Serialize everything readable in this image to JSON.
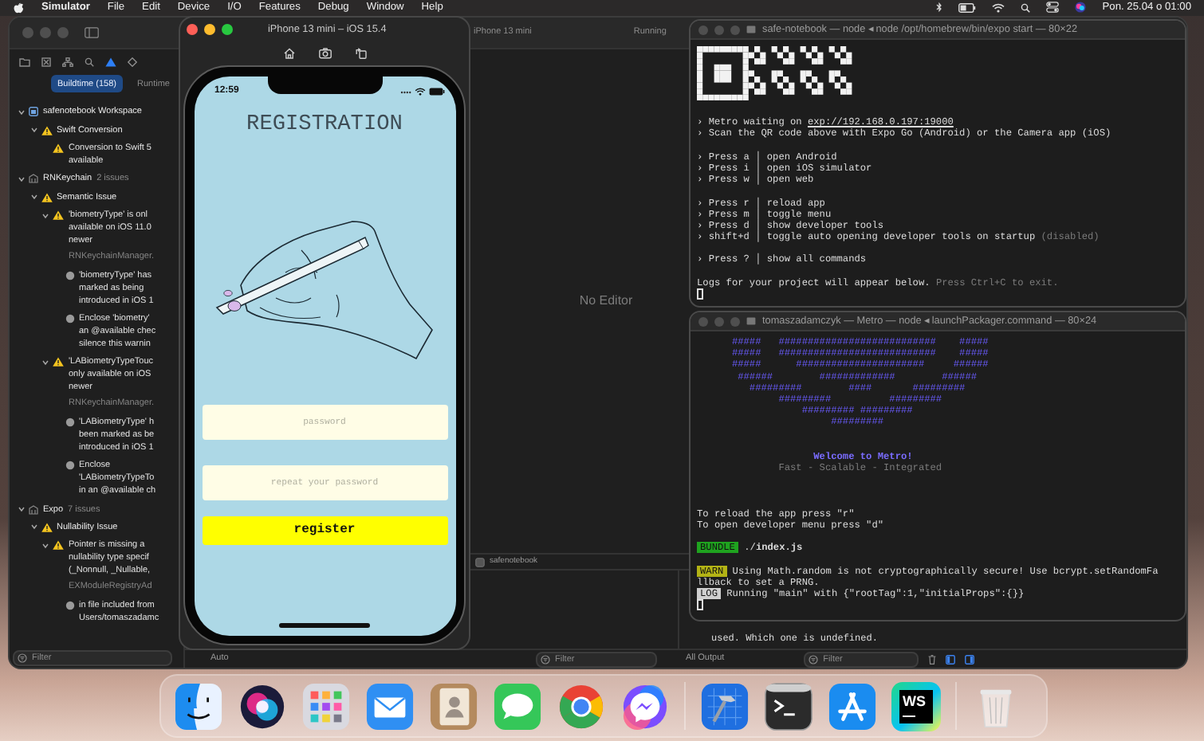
{
  "menu_bar": {
    "app": "Simulator",
    "items": [
      "File",
      "Edit",
      "Device",
      "I/O",
      "Features",
      "Debug",
      "Window",
      "Help"
    ],
    "clock": "Pon. 25.04 o 01:00"
  },
  "xcode": {
    "toolbar": {
      "device": "iPhone 13 mini",
      "status": "Running"
    },
    "navigator_tabs": [
      {
        "label": "Buildtime (158)",
        "selected": true
      },
      {
        "label": "Runtime",
        "selected": false
      }
    ],
    "issues": [
      {
        "kind": "workspace",
        "title": "safenotebook Workspace",
        "expanded": true,
        "children": [
          {
            "kind": "category",
            "title": "Swift Conversion",
            "expanded": true,
            "children": [
              {
                "kind": "issue",
                "lines": [
                  "Conversion to Swift 5",
                  "available"
                ]
              }
            ]
          }
        ]
      },
      {
        "kind": "project",
        "title": "RNKeychain",
        "count": "2 issues",
        "expanded": true,
        "children": [
          {
            "kind": "category",
            "title": "Semantic Issue",
            "expanded": true,
            "children": [
              {
                "kind": "issue",
                "lines": [
                  "'biometryType' is onl",
                  "available on iOS 11.0",
                  "newer"
                ],
                "file": "RNKeychainManager.",
                "expanded": true,
                "children": [
                  {
                    "kind": "note",
                    "lines": [
                      "'biometryType' has",
                      "marked as being",
                      "introduced in iOS 1"
                    ]
                  },
                  {
                    "kind": "note",
                    "lines": [
                      "Enclose 'biometry'",
                      "an @available chec",
                      "silence this warnin"
                    ]
                  }
                ]
              },
              {
                "kind": "issue",
                "lines": [
                  "'LABiometryTypeTouc",
                  "only available on iOS",
                  "newer"
                ],
                "file": "RNKeychainManager.",
                "expanded": true,
                "children": [
                  {
                    "kind": "note",
                    "lines": [
                      "'LABiometryType' h",
                      "been marked as be",
                      "introduced in iOS 1"
                    ]
                  },
                  {
                    "kind": "note",
                    "lines": [
                      "Enclose",
                      "'LABiometryTypeTo",
                      "in an @available ch"
                    ]
                  }
                ]
              }
            ]
          }
        ]
      },
      {
        "kind": "project",
        "title": "Expo",
        "count": "7 issues",
        "expanded": true,
        "children": [
          {
            "kind": "category",
            "title": "Nullability Issue",
            "expanded": true,
            "children": [
              {
                "kind": "issue",
                "lines": [
                  "Pointer is missing a",
                  "nullability type specif",
                  "(_Nonnull, _Nullable,"
                ],
                "file": "EXModuleRegistryAd",
                "expanded": true,
                "children": [
                  {
                    "kind": "note",
                    "lines": [
                      "in file included from",
                      "Users/tomaszadamc"
                    ]
                  }
                ]
              }
            ]
          }
        ]
      }
    ],
    "navigator_filter": {
      "placeholder": "Filter"
    },
    "editor_message": "No Editor",
    "debug_target": "safenotebook",
    "variables_scope": "Auto",
    "variables_filter": {
      "placeholder": "Filter"
    },
    "console_text": "used. Which one is undefined.",
    "output_menu": "All Output",
    "console_filter": {
      "placeholder": "Filter"
    }
  },
  "simulator": {
    "title": "iPhone 13 mini – iOS 15.4",
    "time": "12:59",
    "screen_title": "REGISTRATION",
    "fields": [
      {
        "placeholder": "password"
      },
      {
        "placeholder": "repeat your password"
      }
    ],
    "button": "register"
  },
  "terminals": [
    {
      "title": "safe-notebook — node ◂ node /opt/homebrew/bin/expo start — 80×22",
      "qr": true,
      "lines": [
        {
          "kind": "blank"
        },
        {
          "kind": "text",
          "spans": [
            {
              "kind": "plain",
              "text": "› Metro waiting on "
            },
            {
              "kind": "link",
              "text": "exp://192.168.0.197:19000"
            }
          ]
        },
        {
          "kind": "text",
          "spans": [
            {
              "kind": "plain",
              "text": "› Scan the QR code above with Expo Go (Android) or the Camera app (iOS)"
            }
          ]
        },
        {
          "kind": "blank"
        },
        {
          "kind": "text",
          "spans": [
            {
              "kind": "plain",
              "text": "› Press a │ open Android"
            }
          ]
        },
        {
          "kind": "text",
          "spans": [
            {
              "kind": "plain",
              "text": "› Press i │ open iOS simulator"
            }
          ]
        },
        {
          "kind": "text",
          "spans": [
            {
              "kind": "plain",
              "text": "› Press w │ open web"
            }
          ]
        },
        {
          "kind": "blank"
        },
        {
          "kind": "text",
          "spans": [
            {
              "kind": "plain",
              "text": "› Press r │ reload app"
            }
          ]
        },
        {
          "kind": "text",
          "spans": [
            {
              "kind": "plain",
              "text": "› Press m │ toggle menu"
            }
          ]
        },
        {
          "kind": "text",
          "spans": [
            {
              "kind": "plain",
              "text": "› Press d │ show developer tools"
            }
          ]
        },
        {
          "kind": "text",
          "spans": [
            {
              "kind": "plain",
              "text": "› shift+d │ toggle auto opening developer tools on startup "
            },
            {
              "kind": "dim",
              "text": "(disabled)"
            }
          ]
        },
        {
          "kind": "blank"
        },
        {
          "kind": "text",
          "spans": [
            {
              "kind": "plain",
              "text": "› Press ? │ show all commands"
            }
          ]
        },
        {
          "kind": "blank"
        },
        {
          "kind": "text",
          "spans": [
            {
              "kind": "plain",
              "text": "Logs for your project will appear below. "
            },
            {
              "kind": "dim",
              "text": "Press Ctrl+C to exit."
            }
          ]
        },
        {
          "kind": "cursor"
        }
      ]
    },
    {
      "title": "tomaszadamczyk — Metro — node ◂ launchPackager.command — 80×24",
      "qr": false,
      "lines": [
        {
          "kind": "text",
          "spans": [
            {
              "kind": "art",
              "text": "      #####   ###########################    #####"
            }
          ]
        },
        {
          "kind": "text",
          "spans": [
            {
              "kind": "art",
              "text": "      #####   ###########################    #####"
            }
          ]
        },
        {
          "kind": "text",
          "spans": [
            {
              "kind": "art",
              "text": "      #####      ######################     ######"
            }
          ]
        },
        {
          "kind": "text",
          "spans": [
            {
              "kind": "art",
              "text": "       ######        #############        ######"
            }
          ]
        },
        {
          "kind": "text",
          "spans": [
            {
              "kind": "art",
              "text": "         #########        ####       #########"
            }
          ]
        },
        {
          "kind": "text",
          "spans": [
            {
              "kind": "art",
              "text": "              #########          #########"
            }
          ]
        },
        {
          "kind": "text",
          "spans": [
            {
              "kind": "art",
              "text": "                  ######### #########"
            }
          ]
        },
        {
          "kind": "text",
          "spans": [
            {
              "kind": "art",
              "text": "                       #########"
            }
          ]
        },
        {
          "kind": "blank"
        },
        {
          "kind": "blank"
        },
        {
          "kind": "text",
          "spans": [
            {
              "kind": "title",
              "text": "                    Welcome to Metro!"
            }
          ]
        },
        {
          "kind": "text",
          "spans": [
            {
              "kind": "dim",
              "text": "              Fast - Scalable - Integrated"
            }
          ]
        },
        {
          "kind": "blank"
        },
        {
          "kind": "blank"
        },
        {
          "kind": "blank"
        },
        {
          "kind": "text",
          "spans": [
            {
              "kind": "plain",
              "text": "To reload the app press \"r\""
            }
          ]
        },
        {
          "kind": "text",
          "spans": [
            {
              "kind": "plain",
              "text": "To open developer menu press \"d\""
            }
          ]
        },
        {
          "kind": "blank"
        },
        {
          "kind": "text",
          "spans": [
            {
              "kind": "badge",
              "text": "BUNDLE",
              "color": "#1fa31f"
            },
            {
              "kind": "plain",
              "text": " ./**index.js**"
            }
          ]
        },
        {
          "kind": "blank"
        },
        {
          "kind": "text",
          "spans": [
            {
              "kind": "badge",
              "text": "WARN",
              "color": "#b3b315"
            },
            {
              "kind": "plain",
              "text": " Using Math.random is not cryptographically secure! Use bcrypt.setRandomFa"
            }
          ]
        },
        {
          "kind": "text",
          "spans": [
            {
              "kind": "plain",
              "text": "llback to set a PRNG."
            }
          ]
        },
        {
          "kind": "text",
          "spans": [
            {
              "kind": "badge",
              "text": "LOG",
              "color": "#cfcfcf"
            },
            {
              "kind": "plain",
              "text": " Running \"main\" with {\"rootTag\":1,\"initialProps\":{}}"
            }
          ]
        },
        {
          "kind": "cursor"
        }
      ]
    }
  ],
  "dock": [
    {
      "kind": "face"
    },
    {
      "kind": "orb"
    },
    {
      "kind": "grid"
    },
    {
      "kind": "mail"
    },
    {
      "kind": "contacts"
    },
    {
      "kind": "chat"
    },
    {
      "kind": "browser"
    },
    {
      "kind": "messenger"
    },
    {
      "kind": "separator"
    },
    {
      "kind": "hammer"
    },
    {
      "kind": "terminal"
    },
    {
      "kind": "sticks"
    },
    {
      "kind": "editor",
      "label": "WS"
    },
    {
      "kind": "separator"
    },
    {
      "kind": "trash"
    }
  ]
}
